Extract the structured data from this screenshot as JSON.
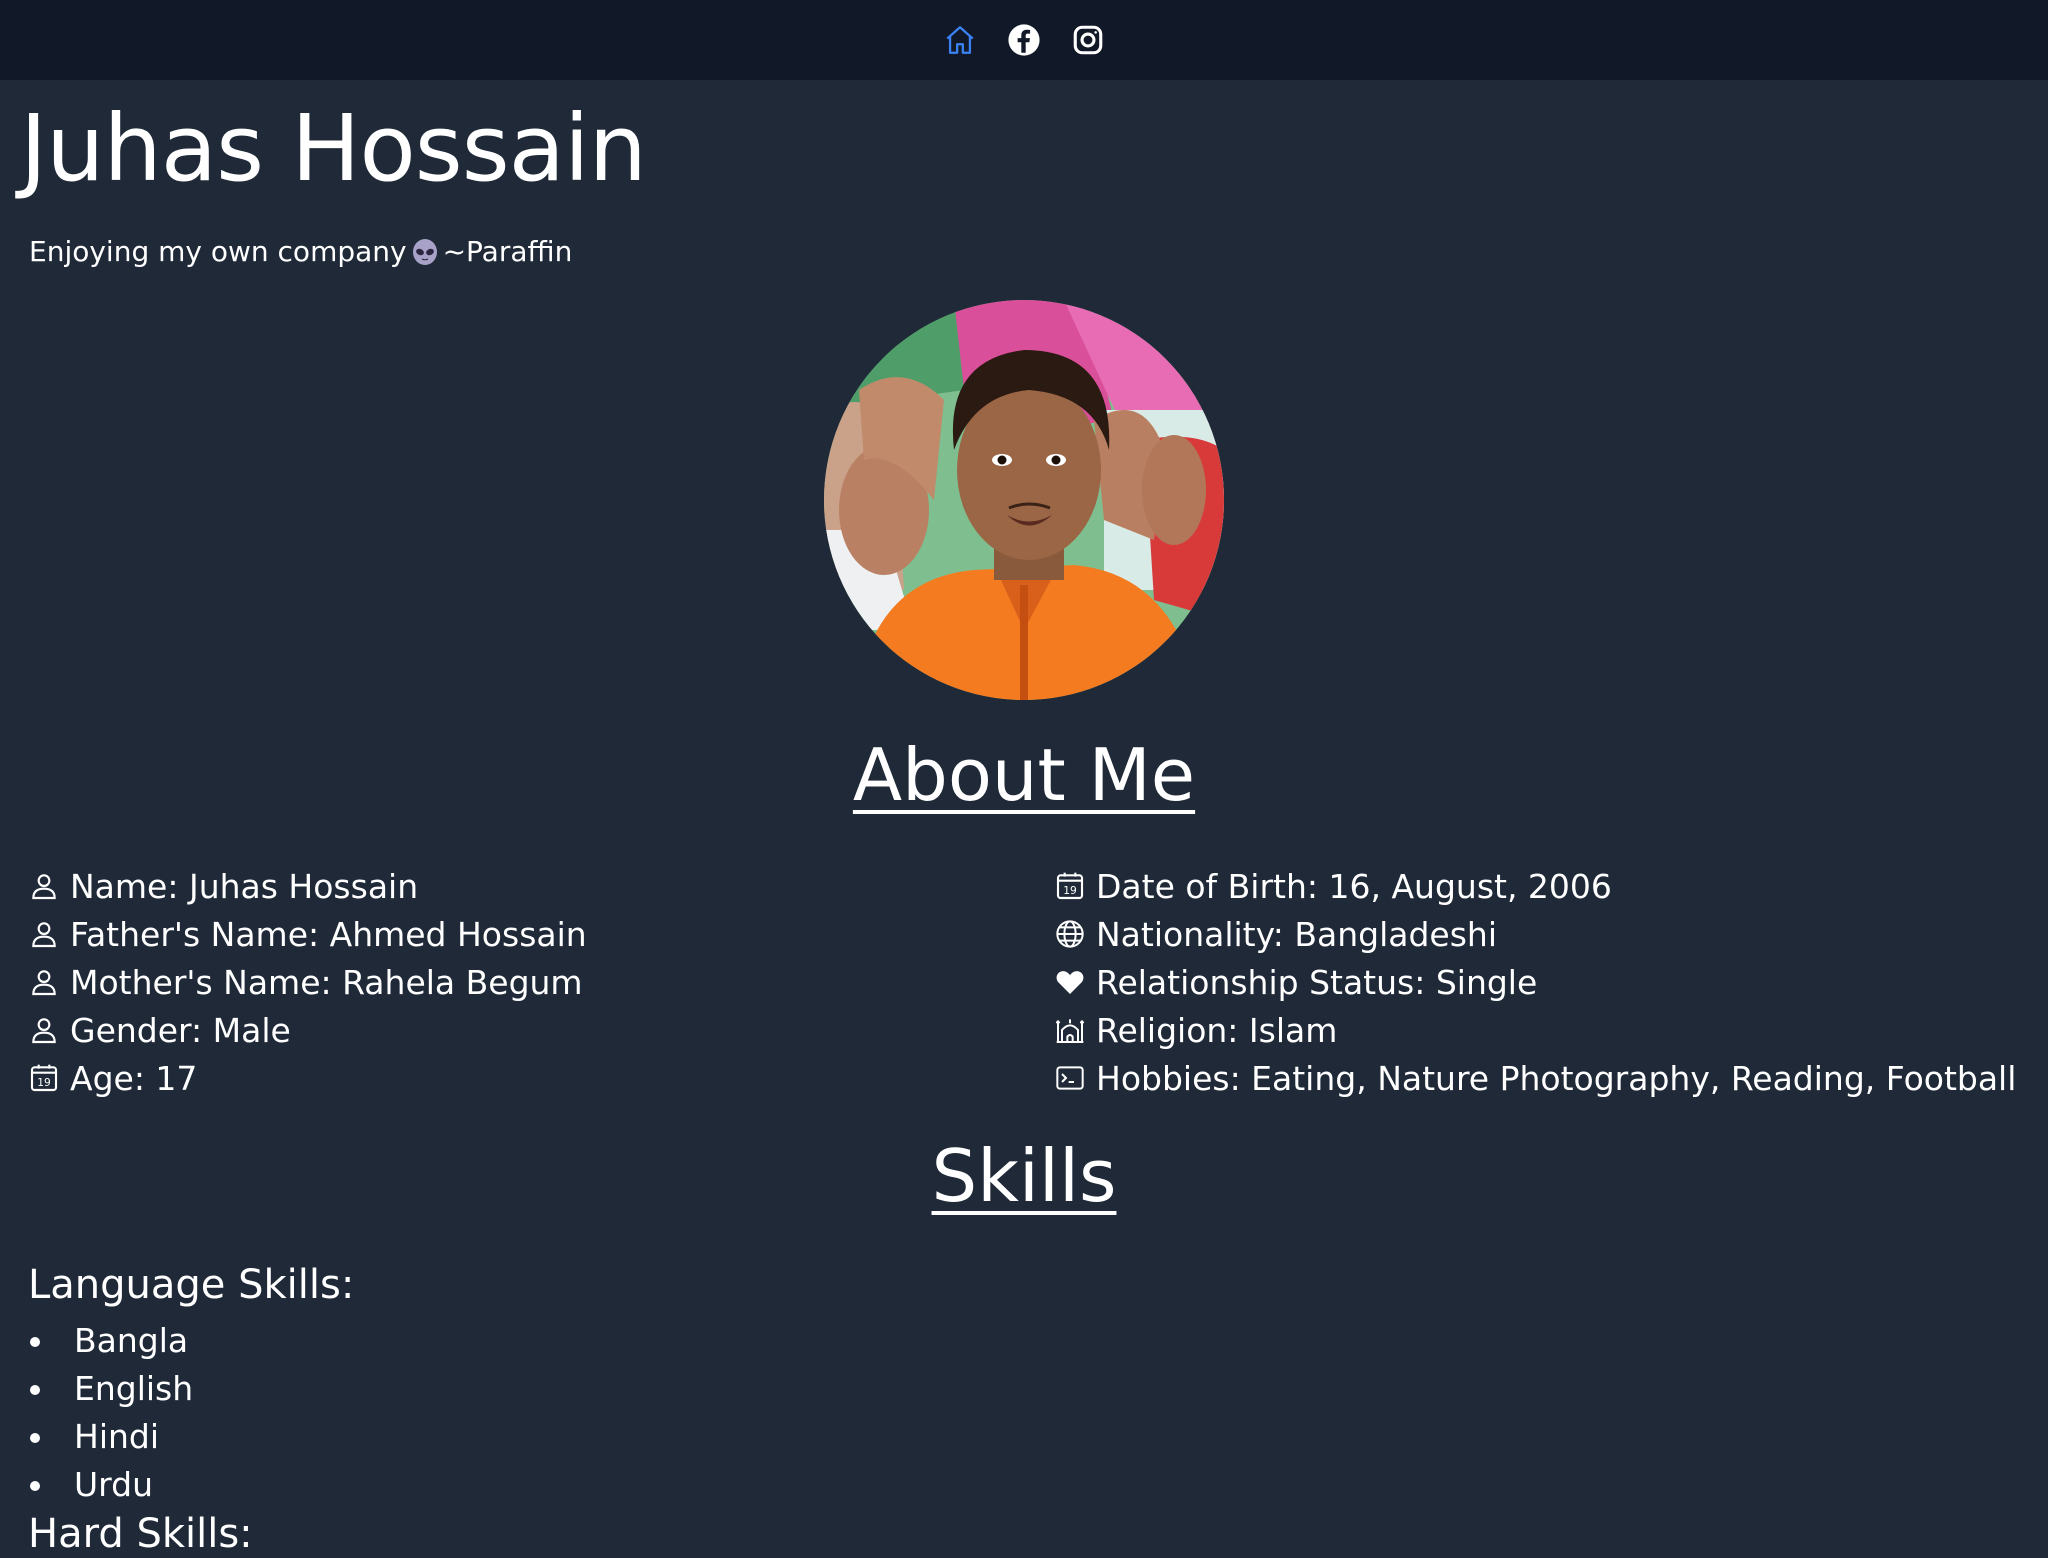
{
  "nav": {
    "items": [
      {
        "icon": "home-icon",
        "color": "#3b82f6"
      },
      {
        "icon": "facebook-icon",
        "color": "#ffffff"
      },
      {
        "icon": "instagram-icon",
        "color": "#ffffff"
      }
    ]
  },
  "profile": {
    "name": "Juhas Hossain",
    "tagline_text": "Enjoying my own company",
    "tagline_emoji": "alien-face-icon",
    "tagline_signature": "~Paraffin"
  },
  "about": {
    "title": "About Me",
    "left": [
      {
        "icon": "person-icon",
        "text": "Name: Juhas Hossain"
      },
      {
        "icon": "person-icon",
        "text": "Father's Name: Ahmed Hossain"
      },
      {
        "icon": "person-icon",
        "text": "Mother's Name: Rahela Begum"
      },
      {
        "icon": "person-icon",
        "text": "Gender: Male"
      },
      {
        "icon": "calendar-icon",
        "text": "Age: 17"
      }
    ],
    "right": [
      {
        "icon": "calendar-icon",
        "text": "Date of Birth: 16, August, 2006"
      },
      {
        "icon": "globe-icon",
        "text": "Nationality: Bangladeshi"
      },
      {
        "icon": "heart-icon",
        "text": "Relationship Status: Single"
      },
      {
        "icon": "mosque-icon",
        "text": "Religion: Islam"
      },
      {
        "icon": "terminal-icon",
        "text": "Hobbies: Eating, Nature Photography, Reading, Football"
      }
    ]
  },
  "skills": {
    "title": "Skills",
    "language_title": "Language Skills:",
    "languages": [
      "Bangla",
      "English",
      "Hindi",
      "Urdu"
    ],
    "hard_title": "Hard Skills:"
  }
}
